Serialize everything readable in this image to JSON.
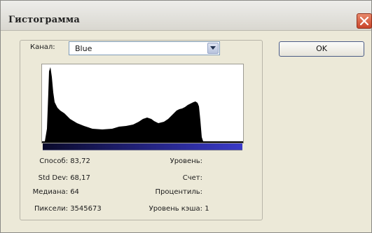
{
  "window": {
    "title": "Гистограмма",
    "close_icon": "close-icon"
  },
  "channel": {
    "label": "Канал:",
    "value": "Blue",
    "icon": "chevron-down-icon"
  },
  "buttons": {
    "ok": "OK"
  },
  "histogram": {
    "channel_color": "#3a3ac8",
    "fill_color": "#000000"
  },
  "stats": {
    "mean_label": "Способ:",
    "mean_value": "83,72",
    "std_label": "Std Dev:",
    "std_value": "68,17",
    "median_label": "Медиана:",
    "median_value": "64",
    "pixels_label": "Пиксели:",
    "pixels_value": "3545673",
    "level_label": "Уровень:",
    "level_value": "",
    "count_label": "Счет:",
    "count_value": "",
    "percentile_label": "Процентиль:",
    "percentile_value": "",
    "cache_label": "Уровень кэша:",
    "cache_value": "1"
  }
}
